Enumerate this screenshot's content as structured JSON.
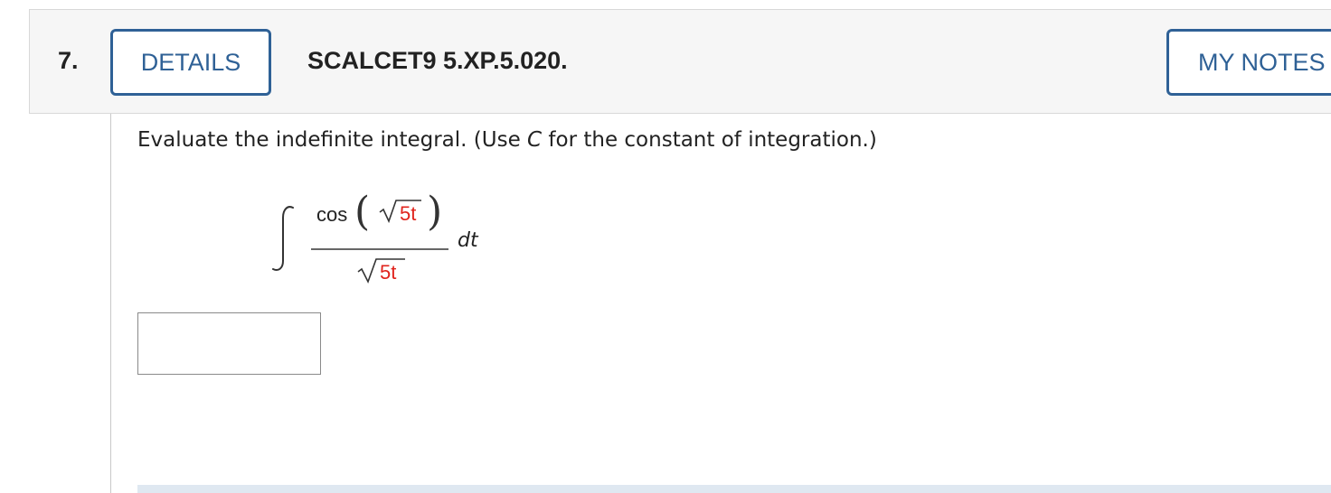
{
  "question": {
    "number": "7.",
    "details_label": "DETAILS",
    "id": "SCALCET9 5.XP.5.020.",
    "notes_label": "MY NOTES"
  },
  "prompt": {
    "before": "Evaluate the indefinite integral. (Use ",
    "var": "C",
    "after": " for the constant of integration.)"
  },
  "math": {
    "func": "cos",
    "inner": "5t",
    "denominator": "5t",
    "differential": "dt"
  },
  "answer": {
    "value": ""
  },
  "colors": {
    "accent": "#2f6196",
    "highlight_red": "#e0231c",
    "header_bg": "#f6f6f6"
  }
}
